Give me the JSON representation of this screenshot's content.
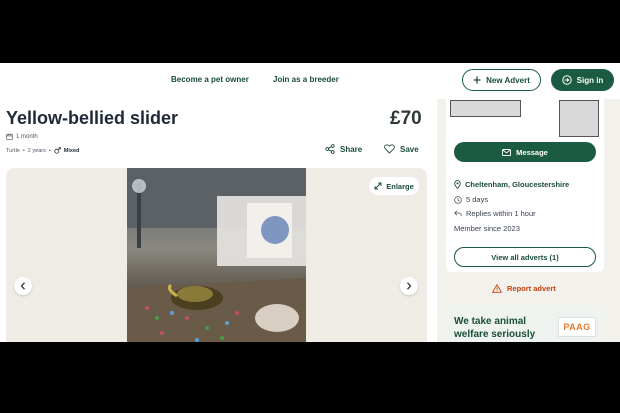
{
  "header": {
    "links": [
      "Become a pet owner",
      "Join as a breeder"
    ],
    "new_advert": "New Advert",
    "sign_in": "Sign in"
  },
  "listing": {
    "title": "Yellow-bellied slider",
    "price": "£70",
    "age": "1 month",
    "species": "Turtle",
    "species_age": "2 years",
    "sex": "Mixed",
    "share": "Share",
    "save": "Save",
    "enlarge": "Enlarge"
  },
  "seller": {
    "message": "Message",
    "location": "Cheltenham, Gloucestershire",
    "last_active": "5 days",
    "replies": "Replies within 1 hour",
    "member_since": "Member since  2023",
    "view_all": "View all adverts (1)"
  },
  "report": "Report advert",
  "promo": {
    "text": "We take animal welfare seriously",
    "logo_text": "PAAG"
  },
  "colors": {
    "brand_green": "#1a5b42",
    "report_orange": "#c2410c"
  }
}
